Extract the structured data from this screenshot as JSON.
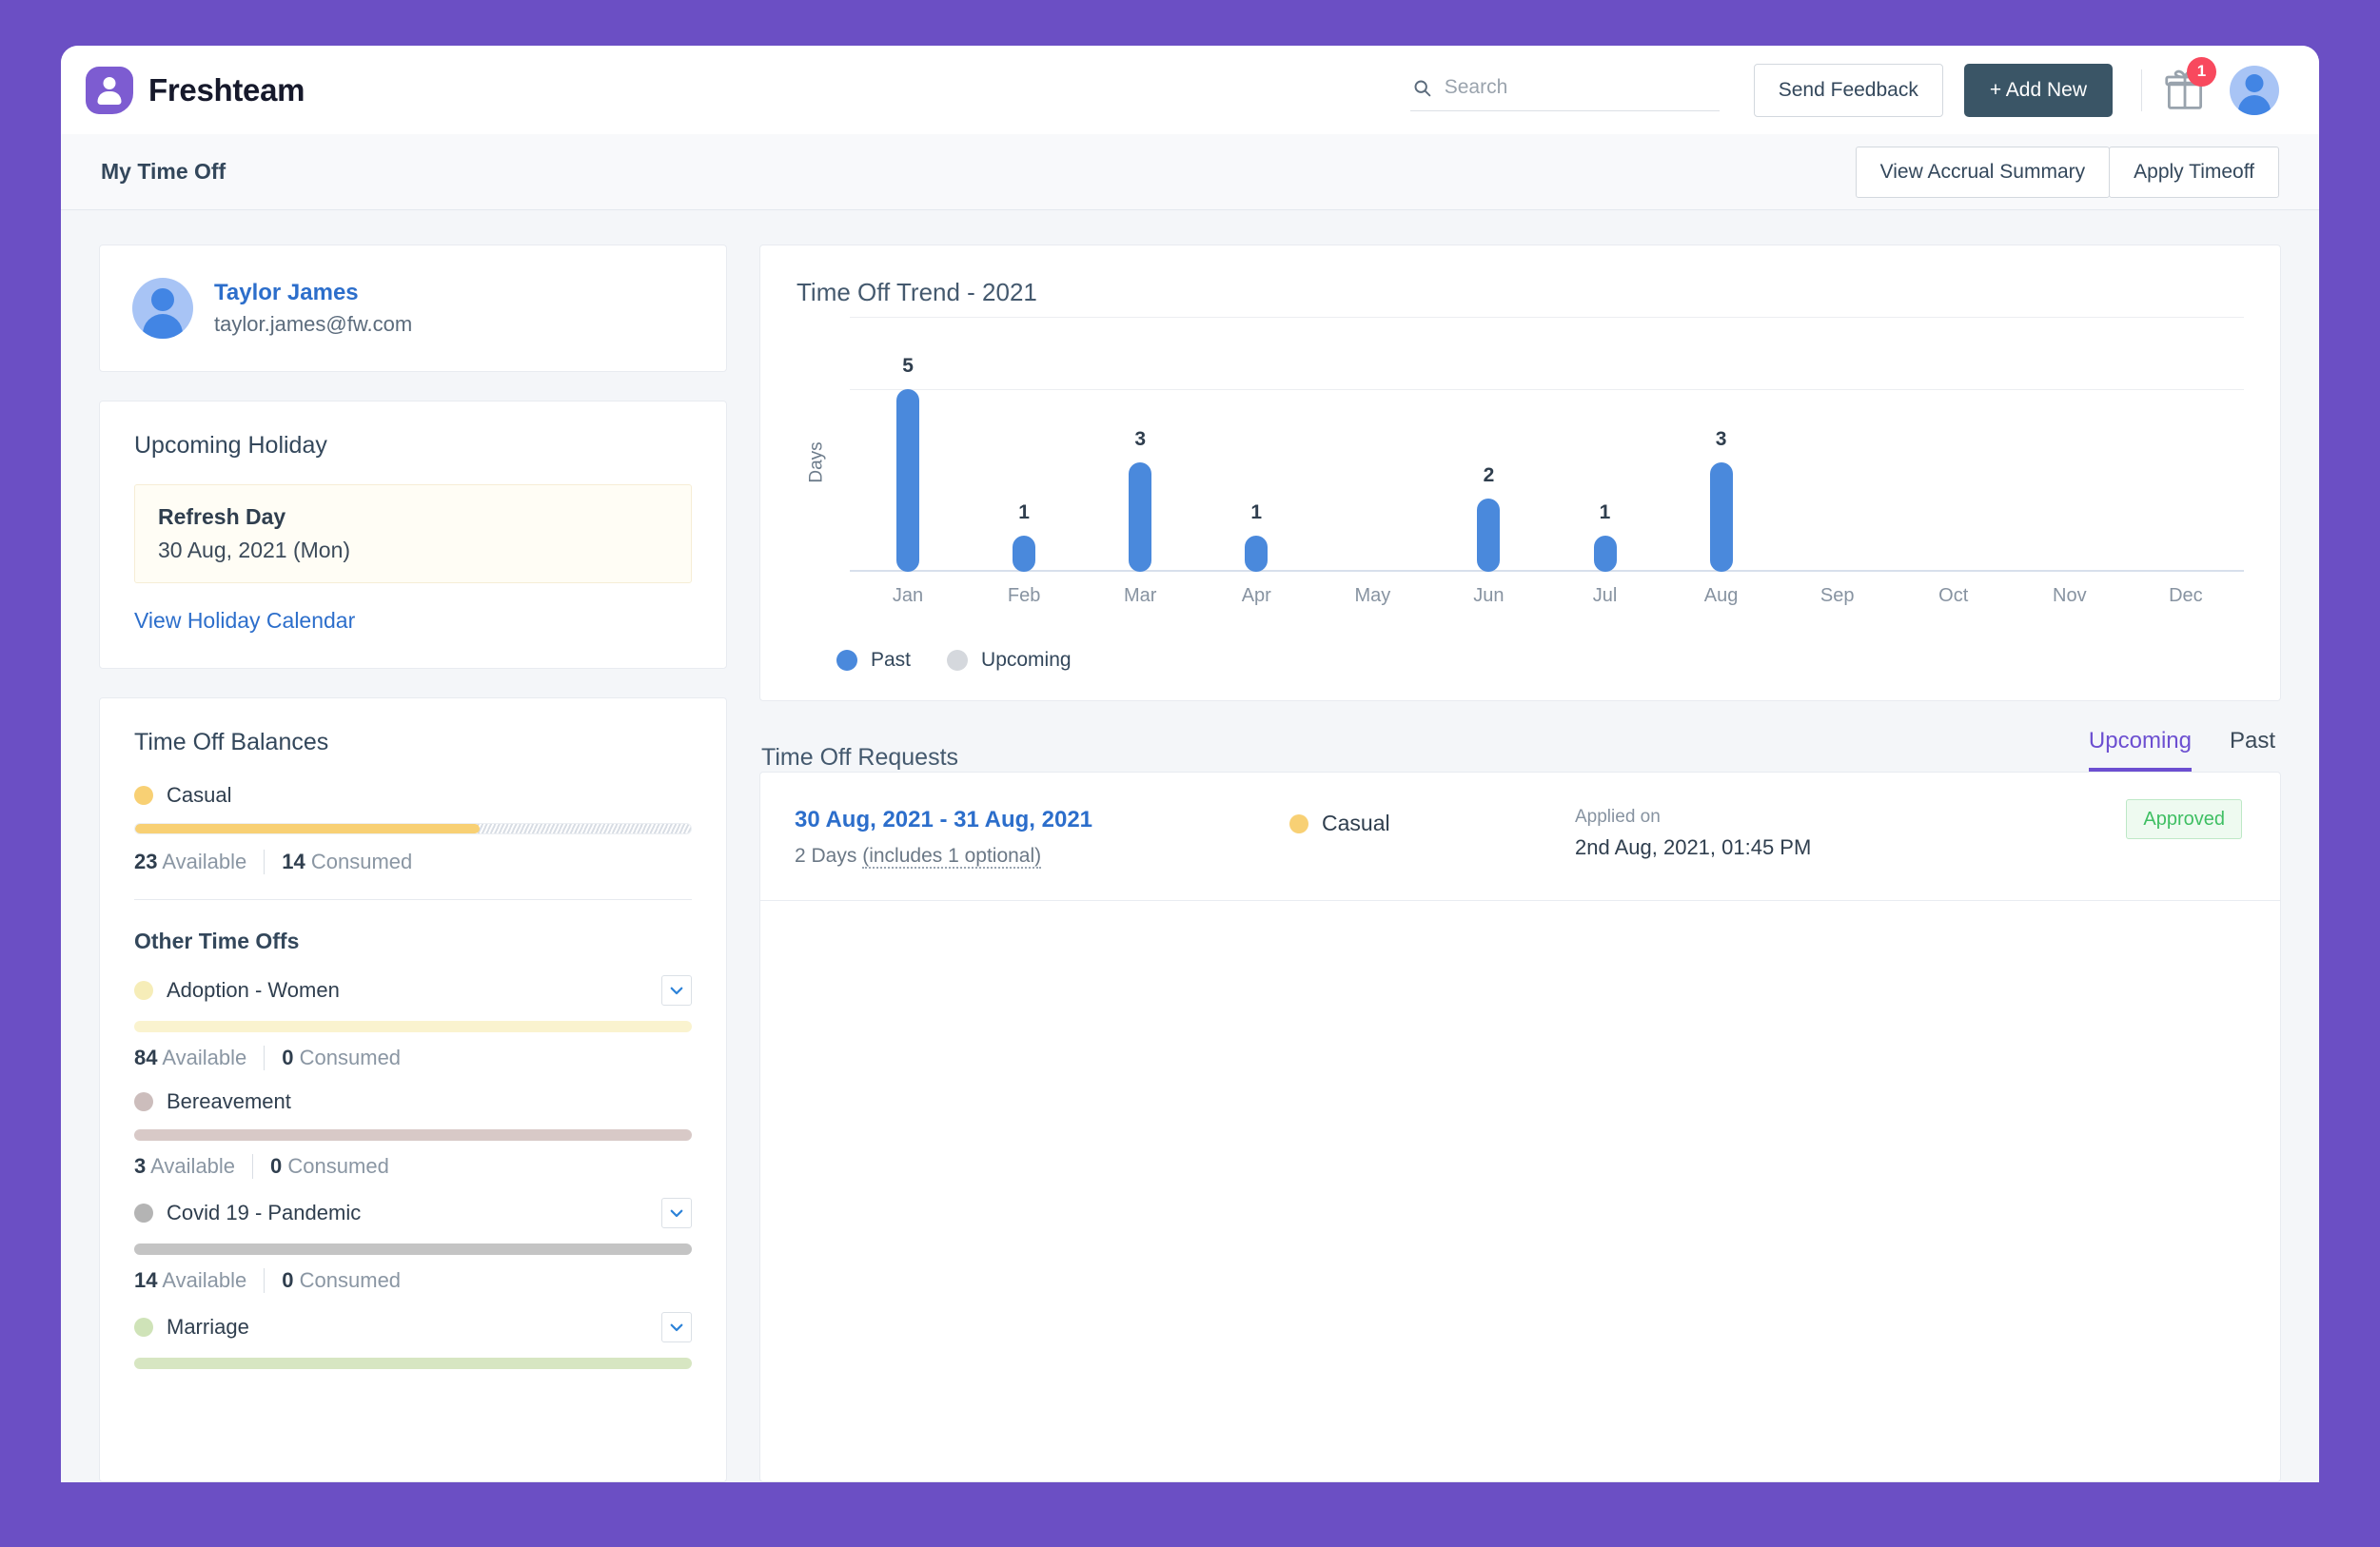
{
  "brand": {
    "name": "Freshteam",
    "logo_icon": "person-in-droplet-icon",
    "color": "#7d5cd1"
  },
  "header": {
    "search": {
      "placeholder": "Search",
      "value": "",
      "icon": "search-icon"
    },
    "send_feedback_label": "Send Feedback",
    "add_new_label": "+ Add New",
    "gift_icon": "gift-icon",
    "gift_badge": "1",
    "avatar_icon": "user-avatar-icon"
  },
  "subheader": {
    "page_title": "My Time Off",
    "view_accrual_label": "View Accrual Summary",
    "apply_timeoff_label": "Apply Timeoff"
  },
  "profile": {
    "name": "Taylor James",
    "email": "taylor.james@fw.com",
    "avatar_icon": "user-avatar-icon"
  },
  "holiday": {
    "title": "Upcoming Holiday",
    "name": "Refresh Day",
    "date": "30 Aug, 2021 (Mon)",
    "link_label": "View Holiday Calendar"
  },
  "balances": {
    "title": "Time Off Balances",
    "primary": {
      "label": "Casual",
      "color": "#f8d074",
      "available_value": "23",
      "available_label": "Available",
      "consumed_value": "14",
      "consumed_label": "Consumed",
      "fill_percent": 62
    },
    "other_title": "Other Time Offs",
    "other": [
      {
        "label": "Adoption - Women",
        "color": "#f6edb8",
        "bar_color": "#faf3cf",
        "available_value": "84",
        "available_label": "Available",
        "consumed_value": "0",
        "consumed_label": "Consumed",
        "has_chevron": true
      },
      {
        "label": "Bereavement",
        "color": "#ccbdbc",
        "bar_color": "#d8c9c7",
        "available_value": "3",
        "available_label": "Available",
        "consumed_value": "0",
        "consumed_label": "Consumed",
        "has_chevron": false
      },
      {
        "label": "Covid 19 - Pandemic",
        "color": "#b4b4b4",
        "bar_color": "#c4c4c4",
        "available_value": "14",
        "available_label": "Available",
        "consumed_value": "0",
        "consumed_label": "Consumed",
        "has_chevron": true
      },
      {
        "label": "Marriage",
        "color": "#cfe3b8",
        "bar_color": "#d7e6c2",
        "available_value": "",
        "available_label": "",
        "consumed_value": "",
        "consumed_label": "",
        "has_chevron": true
      }
    ]
  },
  "chart_data": {
    "type": "bar",
    "title": "Time Off Trend - 2021",
    "xlabel": "",
    "ylabel": "Days",
    "ylim": [
      0,
      6
    ],
    "grid": true,
    "categories": [
      "Jan",
      "Feb",
      "Mar",
      "Apr",
      "May",
      "Jun",
      "Jul",
      "Aug",
      "Sep",
      "Oct",
      "Nov",
      "Dec"
    ],
    "values": [
      5,
      1,
      3,
      1,
      0,
      2,
      1,
      3,
      0,
      0,
      0,
      0
    ],
    "value_labels": [
      "5",
      "1",
      "3",
      "1",
      "",
      "2",
      "1",
      "3",
      "",
      "",
      "",
      ""
    ],
    "series": [
      {
        "name": "Past",
        "color": "#4a89dc",
        "values": [
          5,
          1,
          3,
          1,
          0,
          2,
          1,
          3,
          0,
          0,
          0,
          0
        ]
      },
      {
        "name": "Upcoming",
        "color": "#d5d8dd",
        "values": [
          0,
          0,
          0,
          0,
          0,
          0,
          0,
          0,
          0,
          0,
          0,
          0
        ]
      }
    ],
    "legend": [
      {
        "label": "Past",
        "color": "#4a89dc"
      },
      {
        "label": "Upcoming",
        "color": "#d5d8dd"
      }
    ],
    "legend_position": "bottom-left"
  },
  "requests": {
    "title": "Time Off Requests",
    "tabs": [
      {
        "label": "Upcoming",
        "active": true
      },
      {
        "label": "Past",
        "active": false
      }
    ],
    "rows": [
      {
        "dates": "30 Aug, 2021  -  31 Aug, 2021",
        "duration_prefix": "2 Days ",
        "duration_note": "(includes 1 optional)",
        "type_label": "Casual",
        "type_color": "#f8d074",
        "applied_label": "Applied on",
        "applied_value": "2nd Aug, 2021, 01:45 PM",
        "status": "Approved",
        "status_color": "#3fbf63"
      }
    ]
  }
}
